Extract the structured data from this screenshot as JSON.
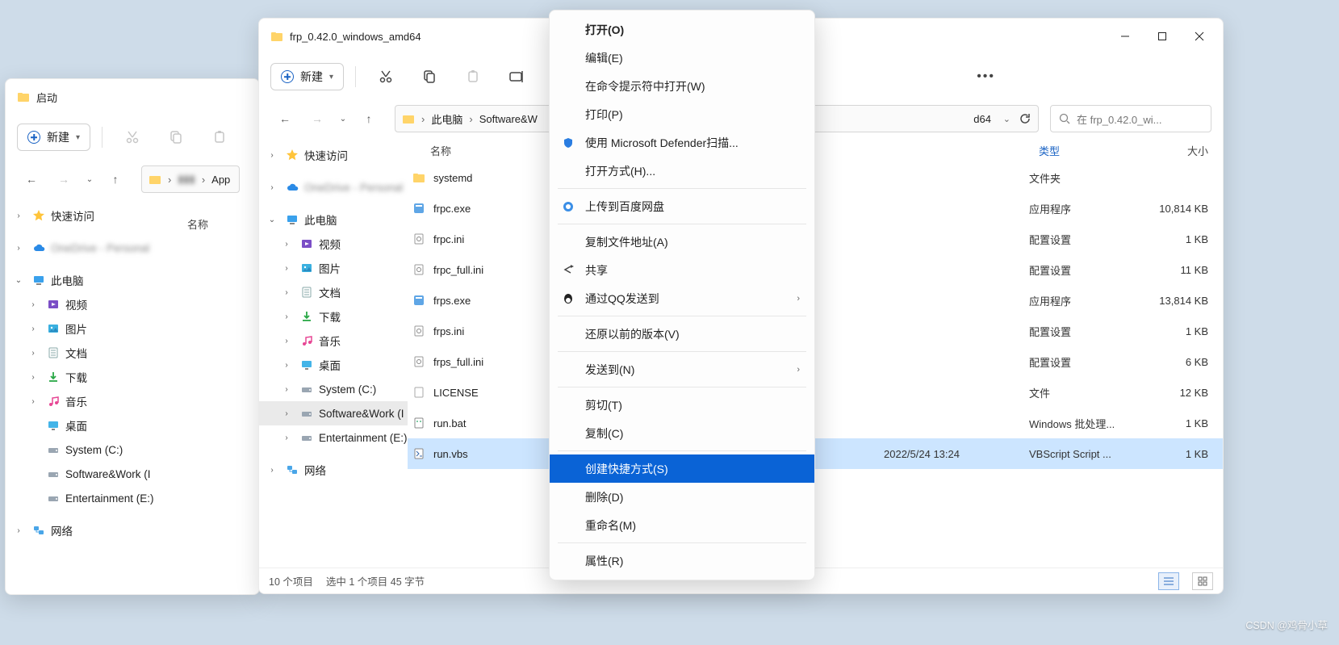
{
  "backWindow": {
    "title": "启动",
    "newLabel": "新建",
    "columnName": "名称",
    "addressCrumbs": [
      "App"
    ],
    "nav": [
      {
        "label": "快速访问",
        "icon": "star",
        "depth": 0,
        "expand": ">"
      },
      {
        "label": "OneDrive - Personal",
        "icon": "cloud",
        "depth": 0,
        "expand": ">",
        "blur": true
      },
      {
        "label": "此电脑",
        "icon": "pc",
        "depth": 0,
        "expand": "v"
      },
      {
        "label": "视频",
        "icon": "video",
        "depth": 1,
        "expand": ">"
      },
      {
        "label": "图片",
        "icon": "image",
        "depth": 1,
        "expand": ">"
      },
      {
        "label": "文档",
        "icon": "doc",
        "depth": 1,
        "expand": ">"
      },
      {
        "label": "下载",
        "icon": "download",
        "depth": 1,
        "expand": ">"
      },
      {
        "label": "音乐",
        "icon": "music",
        "depth": 1,
        "expand": ">"
      },
      {
        "label": "桌面",
        "icon": "desktop",
        "depth": 1,
        "expand": ""
      },
      {
        "label": "System (C:)",
        "icon": "drive",
        "depth": 1,
        "expand": ""
      },
      {
        "label": "Software&Work (I",
        "icon": "drive",
        "depth": 1,
        "expand": ""
      },
      {
        "label": "Entertainment (E:)",
        "icon": "drive",
        "depth": 1,
        "expand": ""
      },
      {
        "label": "网络",
        "icon": "network",
        "depth": 0,
        "expand": ">"
      }
    ]
  },
  "frontWindow": {
    "title": "frp_0.42.0_windows_amd64",
    "newLabel": "新建",
    "breadcrumb": [
      "此电脑",
      "Software&W",
      "",
      "d64"
    ],
    "searchHint": "在 frp_0.42.0_wi...",
    "columns": {
      "name": "名称",
      "date": "",
      "type": "类型",
      "size": "大小"
    },
    "nav": [
      {
        "label": "快速访问",
        "icon": "star",
        "depth": 0,
        "expand": ">"
      },
      {
        "label": "OneDrive - Personal",
        "icon": "cloud",
        "depth": 0,
        "expand": ">",
        "blur": true
      },
      {
        "label": "此电脑",
        "icon": "pc",
        "depth": 0,
        "expand": "v"
      },
      {
        "label": "视频",
        "icon": "video",
        "depth": 1,
        "expand": ">"
      },
      {
        "label": "图片",
        "icon": "image",
        "depth": 1,
        "expand": ">"
      },
      {
        "label": "文档",
        "icon": "doc",
        "depth": 1,
        "expand": ">"
      },
      {
        "label": "下载",
        "icon": "download",
        "depth": 1,
        "expand": ">"
      },
      {
        "label": "音乐",
        "icon": "music",
        "depth": 1,
        "expand": ">"
      },
      {
        "label": "桌面",
        "icon": "desktop",
        "depth": 1,
        "expand": ">"
      },
      {
        "label": "System (C:)",
        "icon": "drive",
        "depth": 1,
        "expand": ">"
      },
      {
        "label": "Software&Work (I",
        "icon": "drive",
        "depth": 1,
        "expand": ">",
        "selected": true
      },
      {
        "label": "Entertainment (E:)",
        "icon": "drive",
        "depth": 1,
        "expand": ">"
      },
      {
        "label": "网络",
        "icon": "network",
        "depth": 0,
        "expand": ">"
      }
    ],
    "files": [
      {
        "name": "systemd",
        "icon": "folder",
        "date": "",
        "type": "文件夹",
        "size": ""
      },
      {
        "name": "frpc.exe",
        "icon": "exe",
        "date": "",
        "type": "应用程序",
        "size": "10,814 KB"
      },
      {
        "name": "frpc.ini",
        "icon": "ini",
        "date": "",
        "type": "配置设置",
        "size": "1 KB"
      },
      {
        "name": "frpc_full.ini",
        "icon": "ini",
        "date": "",
        "type": "配置设置",
        "size": "11 KB"
      },
      {
        "name": "frps.exe",
        "icon": "exe",
        "date": "",
        "type": "应用程序",
        "size": "13,814 KB"
      },
      {
        "name": "frps.ini",
        "icon": "ini",
        "date": "",
        "type": "配置设置",
        "size": "1 KB"
      },
      {
        "name": "frps_full.ini",
        "icon": "ini",
        "date": "",
        "type": "配置设置",
        "size": "6 KB"
      },
      {
        "name": "LICENSE",
        "icon": "file",
        "date": "",
        "type": "文件",
        "size": "12 KB"
      },
      {
        "name": "run.bat",
        "icon": "bat",
        "date": "",
        "type": "Windows 批处理...",
        "size": "1 KB"
      },
      {
        "name": "run.vbs",
        "icon": "vbs",
        "date": "2022/5/24 13:24",
        "type": "VBScript Script ...",
        "size": "1 KB",
        "selected": true
      }
    ],
    "status": {
      "items": "10 个项目",
      "selected": "选中 1 个项目 45 字节"
    }
  },
  "contextMenu": [
    {
      "label": "打开(O)",
      "bold": true
    },
    {
      "label": "编辑(E)"
    },
    {
      "label": "在命令提示符中打开(W)"
    },
    {
      "label": "打印(P)"
    },
    {
      "label": "使用 Microsoft Defender扫描...",
      "icon": "shield"
    },
    {
      "label": "打开方式(H)..."
    },
    {
      "sep": true
    },
    {
      "label": "上传到百度网盘",
      "icon": "baidu"
    },
    {
      "sep": true
    },
    {
      "label": "复制文件地址(A)"
    },
    {
      "label": "共享",
      "icon": "share"
    },
    {
      "label": "通过QQ发送到",
      "icon": "qq",
      "sub": true
    },
    {
      "sep": true
    },
    {
      "label": "还原以前的版本(V)"
    },
    {
      "sep": true
    },
    {
      "label": "发送到(N)",
      "sub": true
    },
    {
      "sep": true
    },
    {
      "label": "剪切(T)"
    },
    {
      "label": "复制(C)"
    },
    {
      "sep": true
    },
    {
      "label": "创建快捷方式(S)",
      "selected": true
    },
    {
      "label": "删除(D)"
    },
    {
      "label": "重命名(M)"
    },
    {
      "sep": true
    },
    {
      "label": "属性(R)"
    }
  ],
  "watermark": "CSDN @鸡骨小草"
}
